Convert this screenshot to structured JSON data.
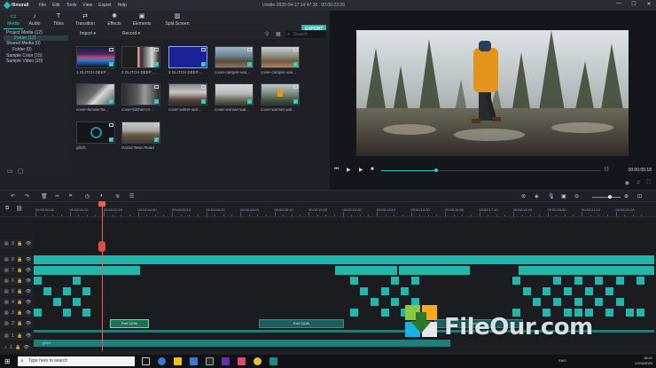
{
  "app": {
    "logo_text": "filmora9",
    "menu": [
      "File",
      "Edit",
      "Tools",
      "View",
      "Export",
      "Help"
    ],
    "document_title": "Untitle-2020-04-17 14 47 36 : 00:00:23:20",
    "window_controls": [
      "—",
      "☐",
      "✕"
    ]
  },
  "modules": [
    {
      "label": "Media",
      "icon": "folder-icon",
      "glyph": "▭",
      "active": true
    },
    {
      "label": "Audio",
      "icon": "music-note-icon",
      "glyph": "♪",
      "active": false
    },
    {
      "label": "Titles",
      "icon": "text-t-icon",
      "glyph": "T",
      "active": false
    },
    {
      "label": "Transition",
      "icon": "transition-icon",
      "glyph": "⇄",
      "active": false
    },
    {
      "label": "Effects",
      "icon": "effects-icon",
      "glyph": "✺",
      "active": false
    },
    {
      "label": "Elements",
      "icon": "elements-icon",
      "glyph": "▣",
      "active": false
    },
    {
      "label": "Split Screen",
      "icon": "split-screen-icon",
      "glyph": "▥",
      "active": false
    }
  ],
  "export_label": "EXPORT",
  "sidebar": {
    "items": [
      {
        "label": "Project Media (12)",
        "selected": false
      },
      {
        "label": "Folder (12)",
        "selected": true
      },
      {
        "label": "Shared Media (0)",
        "selected": false
      },
      {
        "label": "Folder (0)",
        "selected": false
      },
      {
        "label": "Sample Color (15)",
        "selected": false
      },
      {
        "label": "Sample Video (20)",
        "selected": false
      }
    ]
  },
  "media_toolbar": {
    "import_label": "Import",
    "record_label": "Record",
    "search_placeholder": "Search"
  },
  "media_items": [
    {
      "caption": "1 GLITCH DEEP ...",
      "thumb": "glitch1"
    },
    {
      "caption": "2 GLITCH DEEP ...",
      "thumb": "glitch2"
    },
    {
      "caption": "3 GLITCH DEEP ...",
      "thumb": "glitch3"
    },
    {
      "caption": "cover-camper-van...",
      "thumb": "camper"
    },
    {
      "caption": "cover-camper-van...",
      "thumb": "camper2"
    },
    {
      "caption": "cover-female-ha...",
      "thumb": "female"
    },
    {
      "caption": "cover-kitchen-m...",
      "thumb": "kitchen"
    },
    {
      "caption": "cover-winter-wal...",
      "thumb": "winter"
    },
    {
      "caption": "cover-woman-wal...",
      "thumb": "woman"
    },
    {
      "caption": "cover-woman-wal...",
      "thumb": "woman2"
    },
    {
      "caption": "glitch",
      "thumb": "glitch"
    },
    {
      "caption": "Grand Teton Road",
      "thumb": "road"
    }
  ],
  "preview": {
    "timecode": "00:00:05:18",
    "progress": 0.25
  },
  "ruler_labels": [
    "00:00:00:00",
    "00:00:01:10",
    "00:00:02:20",
    "00:00:04:00",
    "00:00:05:10",
    "00:00:06:20",
    "00:00:08:00",
    "00:00:09:10",
    "00:00:10:20",
    "00:00:12:00",
    "00:00:13:10",
    "00:00:14:20",
    "00:00:16:00",
    "00:00:17:10",
    "00:00:18:20",
    "00:00:20:00",
    "00:00:21:10",
    "00:00:22:20"
  ],
  "track_labels": [
    "▤ 9 🔒 👁",
    "▤ 8 🔒 👁",
    "▤ 7 🔒 👁",
    "▤ 6 🔒 👁",
    "▤ 5 🔒 👁",
    "▤ 4 🔒 👁",
    "▤ 3 🔒 👁",
    "▤ 2 🔒 👁",
    "▤ 1 🔒 👁",
    "♪ 1 🔒 👁"
  ],
  "timeline_clips": {
    "part1": "Part 1(19s",
    "part2": "Part 2(18s",
    "part3": "Part 2(16s",
    "audio": "glitch"
  },
  "watermark": "FileOur.com",
  "taskbar": {
    "search_placeholder": "Type here to search",
    "lang": "ENG",
    "time": "16:21",
    "date": "17/04/2020"
  }
}
